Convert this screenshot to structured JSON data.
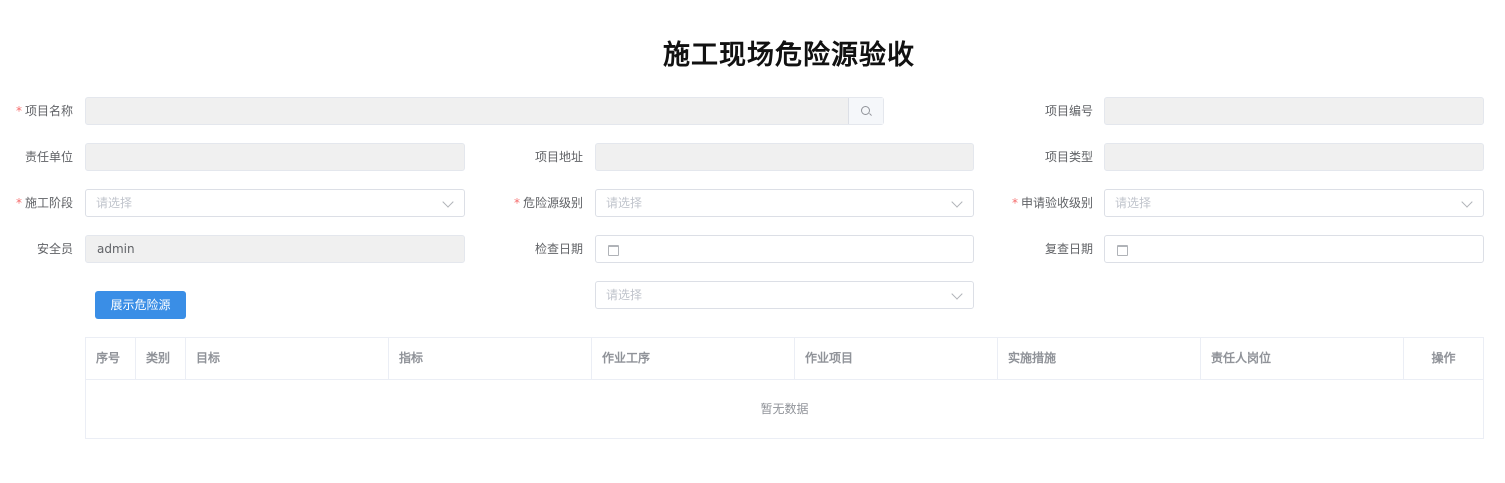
{
  "page": {
    "title": "施工现场危险源验收"
  },
  "form": {
    "project_name": {
      "label": "项目名称",
      "required": true,
      "value": ""
    },
    "project_no": {
      "label": "项目编号",
      "value": ""
    },
    "responsible_unit": {
      "label": "责任单位",
      "value": ""
    },
    "project_address": {
      "label": "项目地址",
      "value": ""
    },
    "project_type": {
      "label": "项目类型",
      "value": ""
    },
    "construction_stage": {
      "label": "施工阶段",
      "required": true,
      "placeholder": "请选择"
    },
    "hazard_level": {
      "label": "危险源级别",
      "required": true,
      "placeholder": "请选择"
    },
    "acceptance_level": {
      "label": "申请验收级别",
      "required": true,
      "placeholder": "请选择"
    },
    "safety_officer": {
      "label": "安全员",
      "value": "admin"
    },
    "check_date": {
      "label": "检查日期",
      "value": ""
    },
    "recheck_date": {
      "label": "复查日期",
      "value": ""
    },
    "extra_select": {
      "placeholder": "请选择"
    },
    "show_hazards_button": "展示危险源"
  },
  "table": {
    "columns": [
      "序号",
      "类别",
      "目标",
      "指标",
      "作业工序",
      "作业项目",
      "实施措施",
      "责任人岗位",
      "操作"
    ],
    "empty_text": "暂无数据"
  },
  "icons": {
    "search": "search-icon",
    "calendar": "calendar-icon",
    "chevron": "chevron-down-icon"
  },
  "colors": {
    "primary": "#3a8ee6",
    "required": "#f56c6c"
  }
}
